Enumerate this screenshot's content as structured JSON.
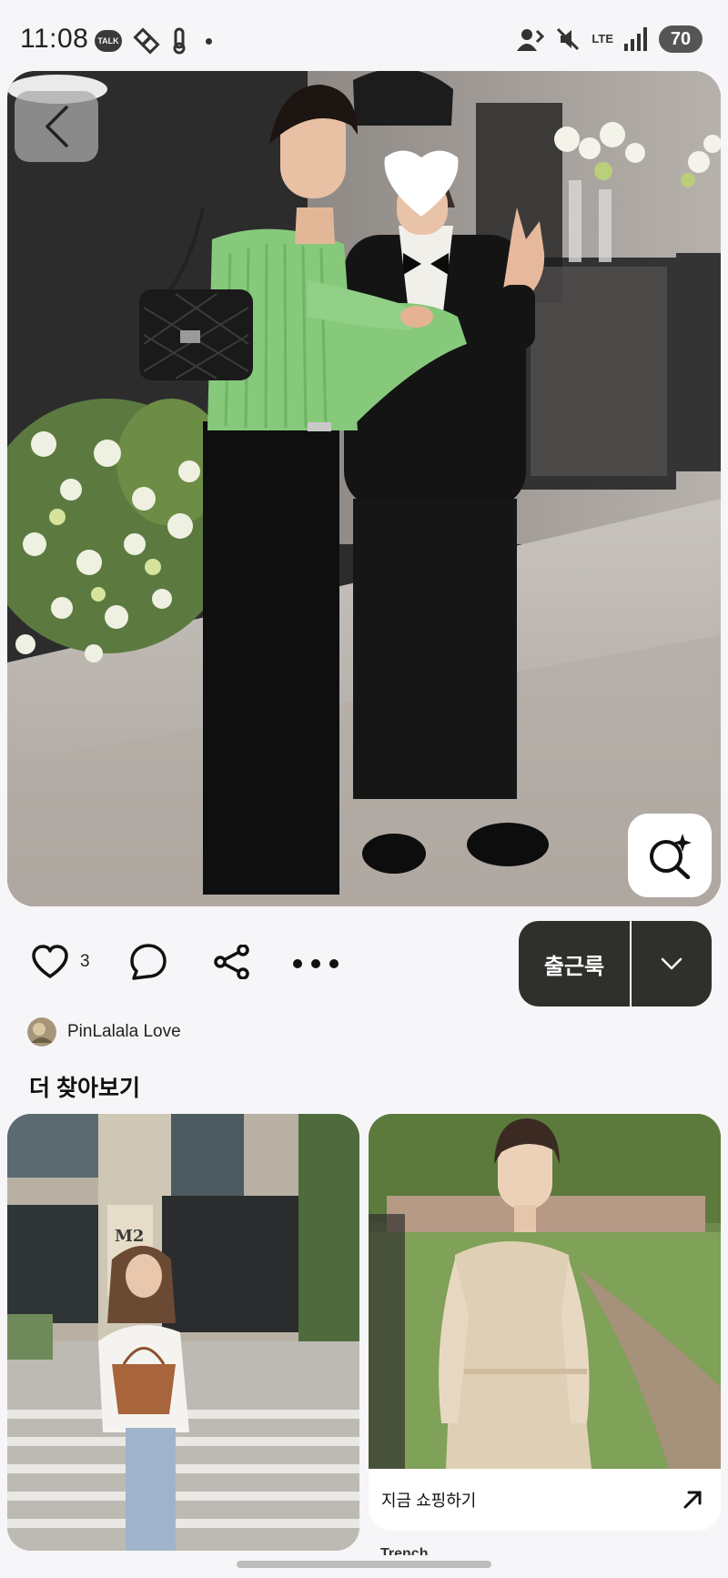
{
  "status_bar": {
    "time": "11:08",
    "talk_label": "TALK",
    "network": "LTE",
    "battery": "70"
  },
  "pin": {
    "image_alt": "Woman in green ribbed knit top with black wide pants and quilted black bag, standing next to man in black tuxedo at a floral wedding venue",
    "like_count": "3",
    "board_name": "출근룩",
    "pinner_name": "PinLalala Love"
  },
  "more_ideas": {
    "title": "더 찾아보기",
    "cards": [
      {
        "alt": "Woman in white blouse, light jeans and woven straw bag on a street crossing in front of a building"
      },
      {
        "alt": "Woman in sheer beige high-neck blouse standing in a park",
        "shop_label": "지금 쇼핑하기",
        "title_peek": "Trench"
      }
    ]
  },
  "colors": {
    "accent_dark": "#2f2f2c",
    "background": "#f6f5f7"
  }
}
